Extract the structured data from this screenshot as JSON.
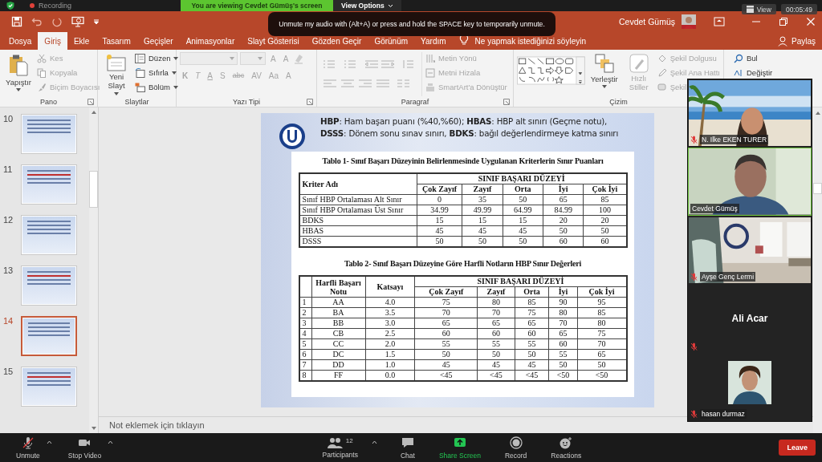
{
  "zoom_bar": {
    "recording": "Recording",
    "banner": "You are viewing Cevdet Gümüş's screen",
    "view_options": "View Options",
    "view": "View",
    "timer": "00:05:49"
  },
  "tooltip": "Unmute my audio with (Alt+A) or press and hold the SPACE key to temporarily unmute.",
  "title_bar": {
    "user": "Cevdet Gümüş"
  },
  "tabs": [
    {
      "label": "Dosya",
      "selected": false
    },
    {
      "label": "Giriş",
      "selected": true
    },
    {
      "label": "Ekle",
      "selected": false
    },
    {
      "label": "Tasarım",
      "selected": false
    },
    {
      "label": "Geçişler",
      "selected": false
    },
    {
      "label": "Animasyonlar",
      "selected": false
    },
    {
      "label": "Slayt Gösterisi",
      "selected": false
    },
    {
      "label": "Gözden Geçir",
      "selected": false
    },
    {
      "label": "Görünüm",
      "selected": false
    },
    {
      "label": "Yardım",
      "selected": false
    }
  ],
  "tell_me": "Ne yapmak istediğinizi söyleyin",
  "share": "Paylaş",
  "ribbon": {
    "clipboard": {
      "label": "Pano",
      "paste": "Yapıştır",
      "items": [
        {
          "label": "Kes",
          "disabled": true
        },
        {
          "label": "Kopyala",
          "disabled": true
        },
        {
          "label": "Biçim Boyacısı",
          "disabled": true
        }
      ]
    },
    "slides": {
      "label": "Slaytlar",
      "new_slide": "Yeni Slayt",
      "items": [
        {
          "label": "Düzen",
          "disabled": false
        },
        {
          "label": "Sıfırla",
          "disabled": false
        },
        {
          "label": "Bölüm",
          "disabled": false
        }
      ]
    },
    "font": {
      "label": "Yazı Tipi",
      "size_buttons": [
        "A",
        "A"
      ],
      "buttons": [
        {
          "label": "K",
          "disabled": true
        },
        {
          "label": "T",
          "disabled": true
        },
        {
          "label": "A",
          "disabled": true
        },
        {
          "label": "S",
          "disabled": true
        },
        {
          "label": "abc",
          "disabled": true
        },
        {
          "label": "AV",
          "disabled": true
        },
        {
          "label": "Aa",
          "disabled": true
        },
        {
          "label": "A",
          "disabled": true
        }
      ]
    },
    "paragraph": {
      "label": "Paragraf",
      "items": [
        {
          "label": "Metin Yönü",
          "disabled": true
        },
        {
          "label": "Metni Hizala",
          "disabled": true
        },
        {
          "label": "SmartArt'a Dönüştür",
          "disabled": true
        }
      ]
    },
    "drawing": {
      "label": "Çizim",
      "arrange": "Yerleştir",
      "quick_styles": "Hızlı Stiller",
      "items": [
        {
          "label": "Şekil Dolgusu",
          "disabled": true
        },
        {
          "label": "Şekil Ana Hattı",
          "disabled": true
        },
        {
          "label": "Şekil",
          "disabled": true
        }
      ]
    },
    "editing": {
      "items": [
        "Bul",
        "Değiştir"
      ]
    }
  },
  "thumbnails": [
    {
      "number": "10",
      "selected": false
    },
    {
      "number": "11",
      "selected": false
    },
    {
      "number": "12",
      "selected": false
    },
    {
      "number": "13",
      "selected": false
    },
    {
      "number": "14",
      "selected": true
    },
    {
      "number": "15",
      "selected": false
    }
  ],
  "slide": {
    "legend": [
      "**HBP**: Ham başarı puanı (%40,%60); **HBAS**: HBP alt sınırı (Geçme notu),",
      "**DSSS**: Dönem sonu sınav sınırı, **BDKS**: bağıl değerlendirmeye katma sınırı"
    ],
    "table1": {
      "title": "Tablo 1- Sınıf Başarı Düzeyinin Belirlenmesinde Uygulanan Kriterlerin Sınır Puanları",
      "criterion_header": "Kriter Adı",
      "group_header": "SINIF BAŞARI DÜZEYİ",
      "levels": [
        "Çok Zayıf",
        "Zayıf",
        "Orta",
        "İyi",
        "Çok İyi"
      ],
      "rows": [
        {
          "label": "Sınıf HBP Ortalaması Alt Sınır",
          "values": [
            "0",
            "35",
            "50",
            "65",
            "85"
          ]
        },
        {
          "label": "Sınıf HBP Ortalaması Üst Sınır",
          "values": [
            "34.99",
            "49.99",
            "64.99",
            "84.99",
            "100"
          ]
        },
        {
          "label": "BDKS",
          "values": [
            "15",
            "15",
            "15",
            "20",
            "20"
          ]
        },
        {
          "label": "HBAS",
          "values": [
            "45",
            "45",
            "45",
            "50",
            "50"
          ]
        },
        {
          "label": "DSSS",
          "values": [
            "50",
            "50",
            "50",
            "60",
            "60"
          ]
        }
      ]
    },
    "table2": {
      "title": "Tablo 2- Sınıf Başarı Düzeyine Göre Harfli Notların HBP Sınır Değerleri",
      "grade_header": "Harfli Başarı Notu",
      "coef_header": "Katsayı",
      "group_header": "SINIF BAŞARI DÜZEYİ",
      "levels": [
        "Çok Zayıf",
        "Zayıf",
        "Orta",
        "İyi",
        "Çok İyi"
      ],
      "rows": [
        {
          "no": "1",
          "grade": "AA",
          "coef": "4.0",
          "values": [
            "75",
            "80",
            "85",
            "90",
            "95"
          ]
        },
        {
          "no": "2",
          "grade": "BA",
          "coef": "3.5",
          "values": [
            "70",
            "70",
            "75",
            "80",
            "85"
          ]
        },
        {
          "no": "3",
          "grade": "BB",
          "coef": "3.0",
          "values": [
            "65",
            "65",
            "65",
            "70",
            "80"
          ]
        },
        {
          "no": "4",
          "grade": "CB",
          "coef": "2.5",
          "values": [
            "60",
            "60",
            "60",
            "65",
            "75"
          ]
        },
        {
          "no": "5",
          "grade": "CC",
          "coef": "2.0",
          "values": [
            "55",
            "55",
            "55",
            "60",
            "70"
          ]
        },
        {
          "no": "6",
          "grade": "DC",
          "coef": "1.5",
          "values": [
            "50",
            "50",
            "50",
            "55",
            "65"
          ]
        },
        {
          "no": "7",
          "grade": "DD",
          "coef": "1.0",
          "values": [
            "45",
            "45",
            "45",
            "50",
            "50"
          ]
        },
        {
          "no": "8",
          "grade": "FF",
          "coef": "0.0",
          "values": [
            "<45",
            "<45",
            "<45",
            "<50",
            "<50"
          ]
        }
      ]
    }
  },
  "notes_placeholder": "Not eklemek için tıklayın",
  "participants": [
    {
      "name": "N. Ilke EKEN TURER",
      "kind": "video",
      "muted": true,
      "speaking": false
    },
    {
      "name": "Cevdet Gümüş",
      "kind": "video",
      "muted": false,
      "speaking": true
    },
    {
      "name": "Ayşe Genç Lermi",
      "kind": "video",
      "muted": true,
      "speaking": false
    },
    {
      "name": "Ali Acar",
      "kind": "name",
      "muted": true,
      "speaking": false
    },
    {
      "name": "hasan durmaz",
      "kind": "avatar",
      "muted": true,
      "speaking": false
    }
  ],
  "toolbar": {
    "unmute": "Unmute",
    "stop_video": "Stop Video",
    "participants": "Participants",
    "participant_count": "12",
    "chat": "Chat",
    "share_screen": "Share Screen",
    "record": "Record",
    "reactions": "Reactions",
    "leave": "Leave"
  }
}
